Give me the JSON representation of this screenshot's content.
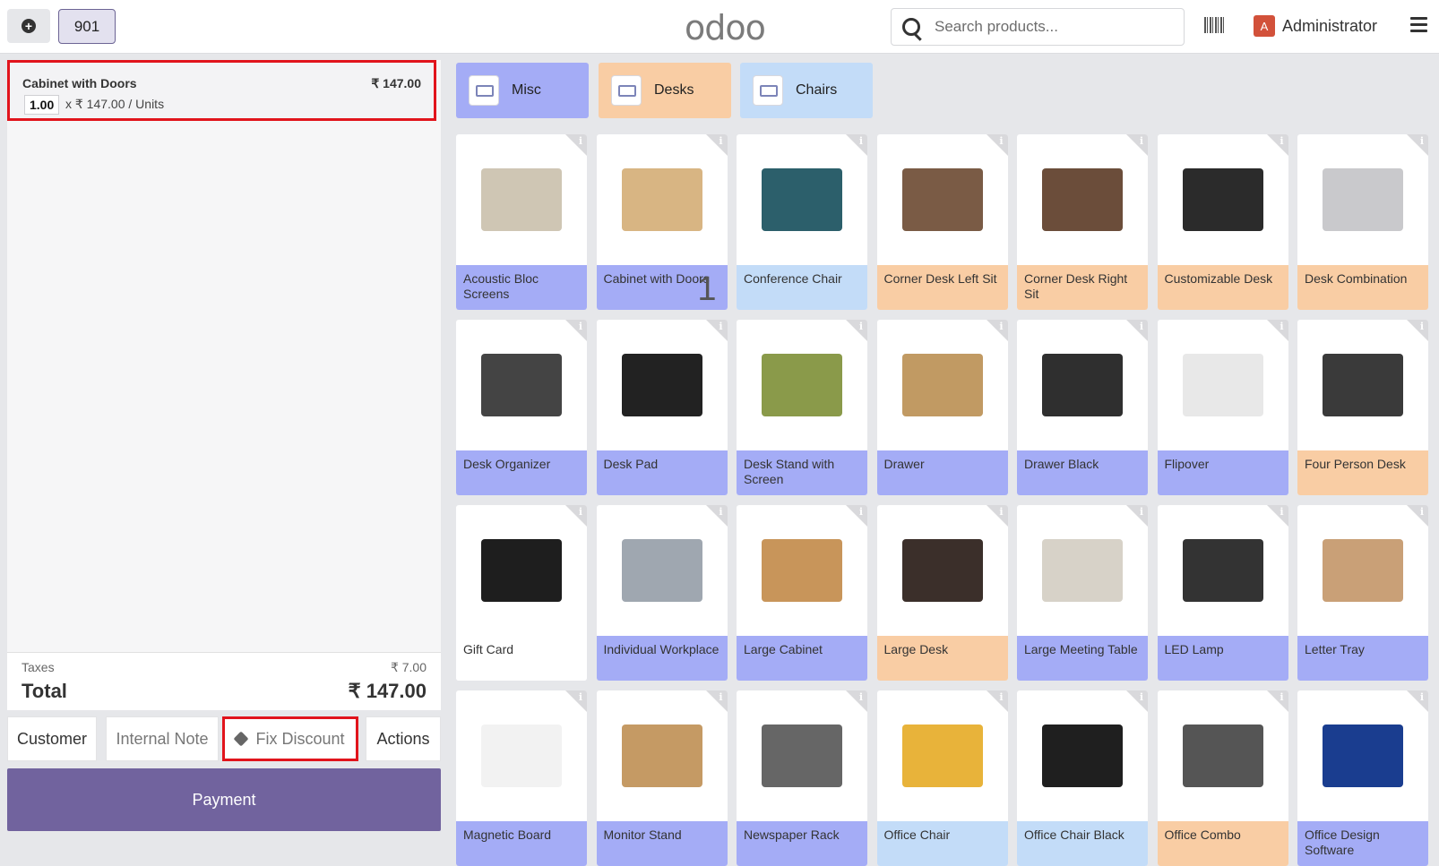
{
  "topbar": {
    "order_number": "901",
    "logo": "odoo",
    "search_placeholder": "Search products...",
    "user_initial": "A",
    "user_name": "Administrator"
  },
  "order": {
    "line": {
      "name": "Cabinet with Doors",
      "price": "₹ 147.00",
      "qty": "1.00",
      "unit_price": "x ₹ 147.00 / Units"
    },
    "taxes_label": "Taxes",
    "taxes_value": "₹ 7.00",
    "total_label": "Total",
    "total_value": "₹ 147.00"
  },
  "controls": {
    "customer": "Customer",
    "internal_note": "Internal Note",
    "fix_discount": "Fix Discount",
    "actions": "Actions",
    "payment": "Payment"
  },
  "categories": [
    {
      "label": "Misc",
      "color": "#a4acf6"
    },
    {
      "label": "Desks",
      "color": "#f9cda4"
    },
    {
      "label": "Chairs",
      "color": "#c3dcf8"
    }
  ],
  "colors": {
    "misc": "#a4acf6",
    "desk": "#f9cda4",
    "chair": "#c3dcf8",
    "plain": "#ffffff",
    "accent": "#71639e",
    "highlight": "#e1141c"
  },
  "products": [
    {
      "name": "Acoustic Bloc Screens",
      "category": "misc"
    },
    {
      "name": "Cabinet with Doors",
      "category": "misc",
      "qty_badge": "1"
    },
    {
      "name": "Conference Chair",
      "category": "chair"
    },
    {
      "name": "Corner Desk Left Sit",
      "category": "desk"
    },
    {
      "name": "Corner Desk Right Sit",
      "category": "desk"
    },
    {
      "name": "Customizable Desk",
      "category": "desk"
    },
    {
      "name": "Desk Combination",
      "category": "desk"
    },
    {
      "name": "Desk Organizer",
      "category": "misc"
    },
    {
      "name": "Desk Pad",
      "category": "misc"
    },
    {
      "name": "Desk Stand with Screen",
      "category": "misc"
    },
    {
      "name": "Drawer",
      "category": "misc"
    },
    {
      "name": "Drawer Black",
      "category": "misc"
    },
    {
      "name": "Flipover",
      "category": "misc"
    },
    {
      "name": "Four Person Desk",
      "category": "desk"
    },
    {
      "name": "Gift Card",
      "category": "plain"
    },
    {
      "name": "Individual Workplace",
      "category": "misc"
    },
    {
      "name": "Large Cabinet",
      "category": "misc"
    },
    {
      "name": "Large Desk",
      "category": "desk"
    },
    {
      "name": "Large Meeting Table",
      "category": "misc"
    },
    {
      "name": "LED Lamp",
      "category": "misc"
    },
    {
      "name": "Letter Tray",
      "category": "misc"
    },
    {
      "name": "Magnetic Board",
      "category": "misc"
    },
    {
      "name": "Monitor Stand",
      "category": "misc"
    },
    {
      "name": "Newspaper Rack",
      "category": "misc"
    },
    {
      "name": "Office Chair",
      "category": "chair"
    },
    {
      "name": "Office Chair Black",
      "category": "chair"
    },
    {
      "name": "Office Combo",
      "category": "desk"
    },
    {
      "name": "Office Design Software",
      "category": "misc"
    }
  ]
}
